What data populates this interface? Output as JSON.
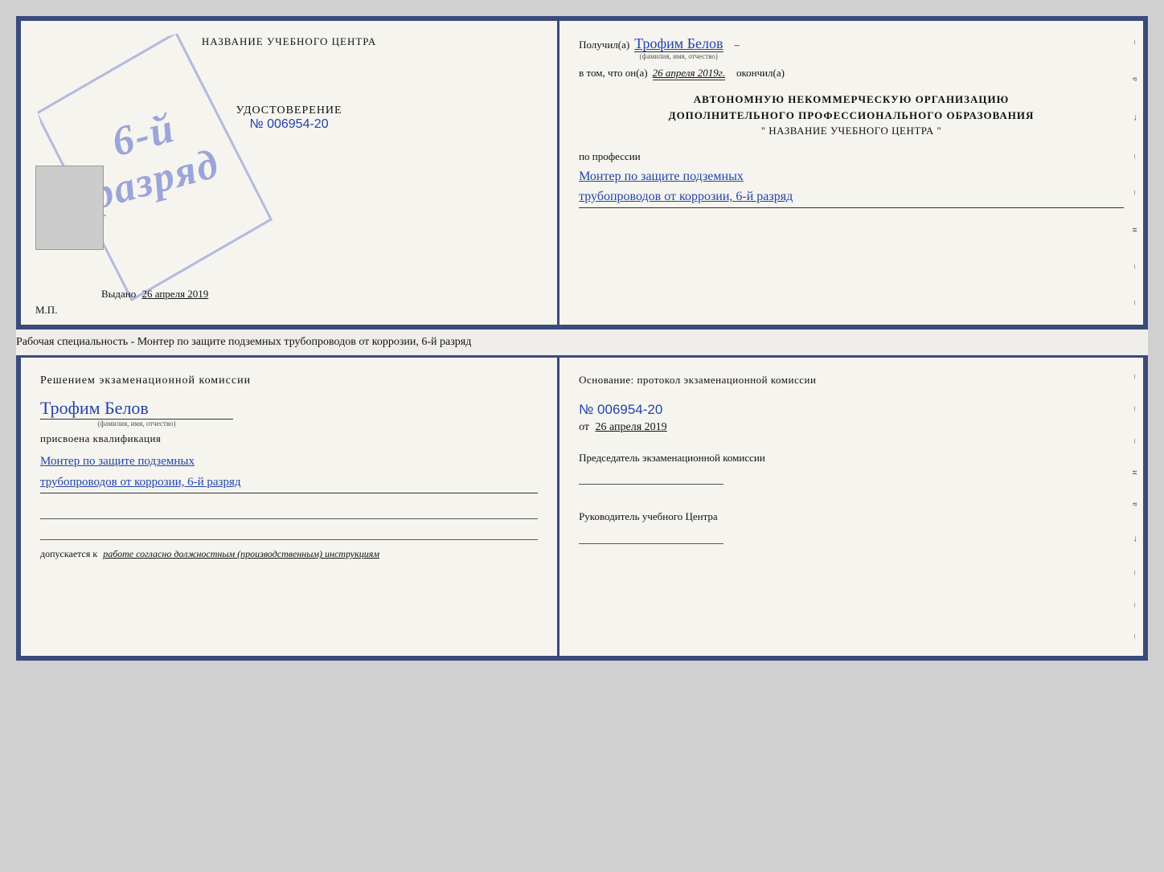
{
  "top_cert": {
    "left": {
      "title": "НАЗВАНИЕ УЧЕБНОГО ЦЕНТРА",
      "stamp_line1": "6-й",
      "stamp_line2": "разряд",
      "udostoverenie_label": "УДОСТОВЕРЕНИЕ",
      "number": "№ 006954-20",
      "photo_alt": "фото",
      "vydano_label": "Выдано",
      "vydano_date": "26 апреля 2019",
      "mp_label": "М.П."
    },
    "right": {
      "poluchil_label": "Получил(а)",
      "recipient_name": "Трофим Белов",
      "name_sub": "(фамилия, имя, отчество)",
      "dash": "–",
      "vtom_label": "в том, что он(а)",
      "date": "26 апреля 2019г.",
      "okonchil_label": "окончил(а)",
      "org_line1": "АВТОНОМНУЮ НЕКОММЕРЧЕСКУЮ ОРГАНИЗАЦИЮ",
      "org_line2": "ДОПОЛНИТЕЛЬНОГО ПРОФЕССИОНАЛЬНОГО ОБРАЗОВАНИЯ",
      "org_name": "\"  НАЗВАНИЕ УЧЕБНОГО ЦЕНТРА  \"",
      "po_professii_label": "по профессии",
      "profession_line1": "Монтер по защите подземных",
      "profession_line2": "трубопроводов от коррозии, 6-й разряд"
    }
  },
  "separator": {
    "text": "Рабочая специальность - Монтер по защите подземных трубопроводов от коррозии, 6-й разряд"
  },
  "bottom_cert": {
    "left": {
      "resheniyem": "Решением экзаменационной комиссии",
      "name": "Трофим Белов",
      "name_sub": "(фамилия, имя, отчество)",
      "prisvoena": "присвоена квалификация",
      "qualification_line1": "Монтер по защите подземных",
      "qualification_line2": "трубопроводов от коррозии, 6-й разряд",
      "dopuskaetsya_label": "допускается к",
      "dopuskaetsya_text": "работе согласно должностным (производственным) инструкциям"
    },
    "right": {
      "osnovanie_label": "Основание: протокол экзаменационной комиссии",
      "protocol_number": "№  006954-20",
      "ot_label": "от",
      "ot_date": "26 апреля 2019",
      "predsedatel_label": "Председатель экзаменационной комиссии",
      "rukovoditel_label": "Руководитель учебного Центра"
    }
  }
}
